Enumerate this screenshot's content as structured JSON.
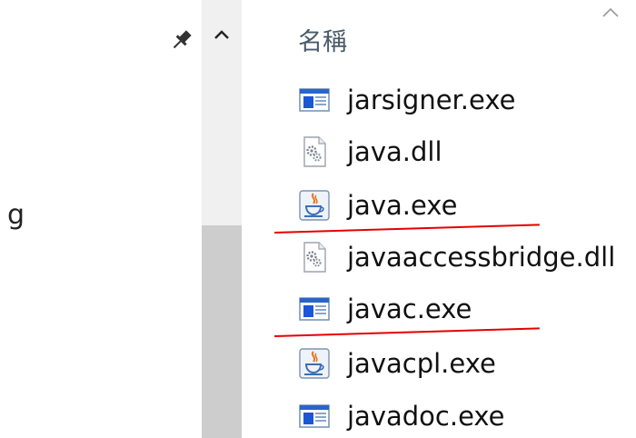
{
  "left_pane": {
    "clipped_text": "g"
  },
  "file_list": {
    "column_header": "名稱",
    "files": [
      {
        "name": "jarsigner.exe",
        "icon": "exe-window-icon"
      },
      {
        "name": "java.dll",
        "icon": "dll-gear-icon"
      },
      {
        "name": "java.exe",
        "icon": "java-cup-icon"
      },
      {
        "name": "javaaccessbridge.dll",
        "icon": "dll-gear-icon"
      },
      {
        "name": "javac.exe",
        "icon": "exe-window-icon"
      },
      {
        "name": "javacpl.exe",
        "icon": "java-cup-icon"
      },
      {
        "name": "javadoc.exe",
        "icon": "exe-window-icon"
      }
    ]
  },
  "colors": {
    "annotation_underline": "#e60000",
    "scroll_thumb": "#cdcdcd",
    "scroll_track": "#f0f0f0"
  }
}
